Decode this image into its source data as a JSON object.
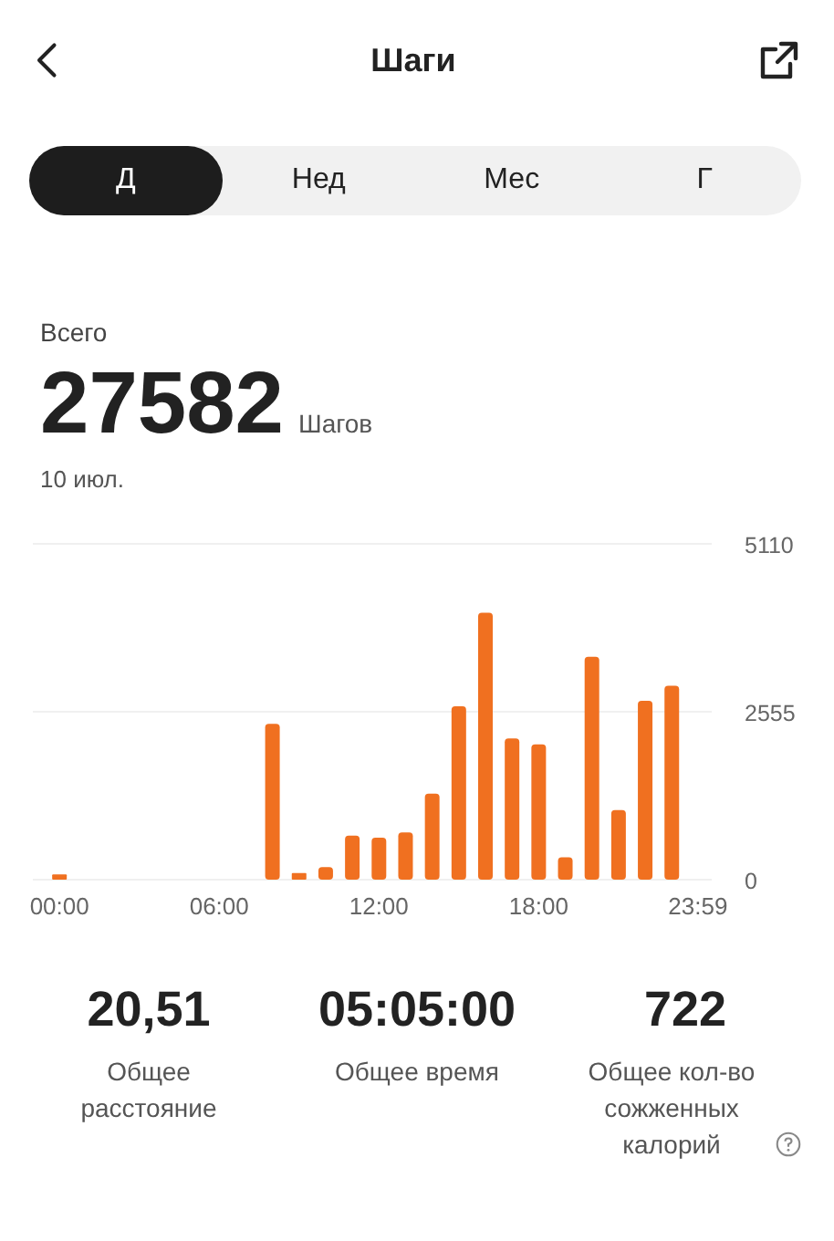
{
  "header": {
    "title": "Шаги"
  },
  "tabs": [
    {
      "label": "Д",
      "selected": true
    },
    {
      "label": "Нед",
      "selected": false
    },
    {
      "label": "Мес",
      "selected": false
    },
    {
      "label": "Г",
      "selected": false
    }
  ],
  "summary": {
    "label": "Всего",
    "value": "27582",
    "unit": "Шагов",
    "date": "10 июл."
  },
  "chart_data": {
    "type": "bar",
    "x": [
      0,
      1,
      2,
      3,
      4,
      5,
      6,
      7,
      8,
      9,
      10,
      11,
      12,
      13,
      14,
      15,
      16,
      17,
      18,
      19,
      20,
      21,
      22,
      23
    ],
    "series": [
      {
        "color": "#f07020",
        "values": [
          80,
          0,
          0,
          0,
          0,
          0,
          0,
          0,
          2370,
          100,
          190,
          670,
          640,
          720,
          1310,
          2640,
          4060,
          2150,
          2060,
          340,
          3390,
          1060,
          2720,
          2950
        ]
      }
    ],
    "xlim": [
      -1,
      24.5
    ],
    "ylim": [
      0,
      5110
    ],
    "yticks": [
      0,
      2555,
      5110
    ],
    "xticks": [
      {
        "value": 0,
        "label": "00:00"
      },
      {
        "value": 6,
        "label": "06:00"
      },
      {
        "value": 12,
        "label": "12:00"
      },
      {
        "value": 18,
        "label": "18:00"
      },
      {
        "value": 23.98,
        "label": "23:59"
      }
    ]
  },
  "stats": [
    {
      "value": "20,51",
      "label": "Общее расстояние",
      "help": false
    },
    {
      "value": "05:05:00",
      "label": "Общее время",
      "help": false
    },
    {
      "value": "722",
      "label": "Общее кол-во сожженных калорий",
      "help": true
    }
  ]
}
